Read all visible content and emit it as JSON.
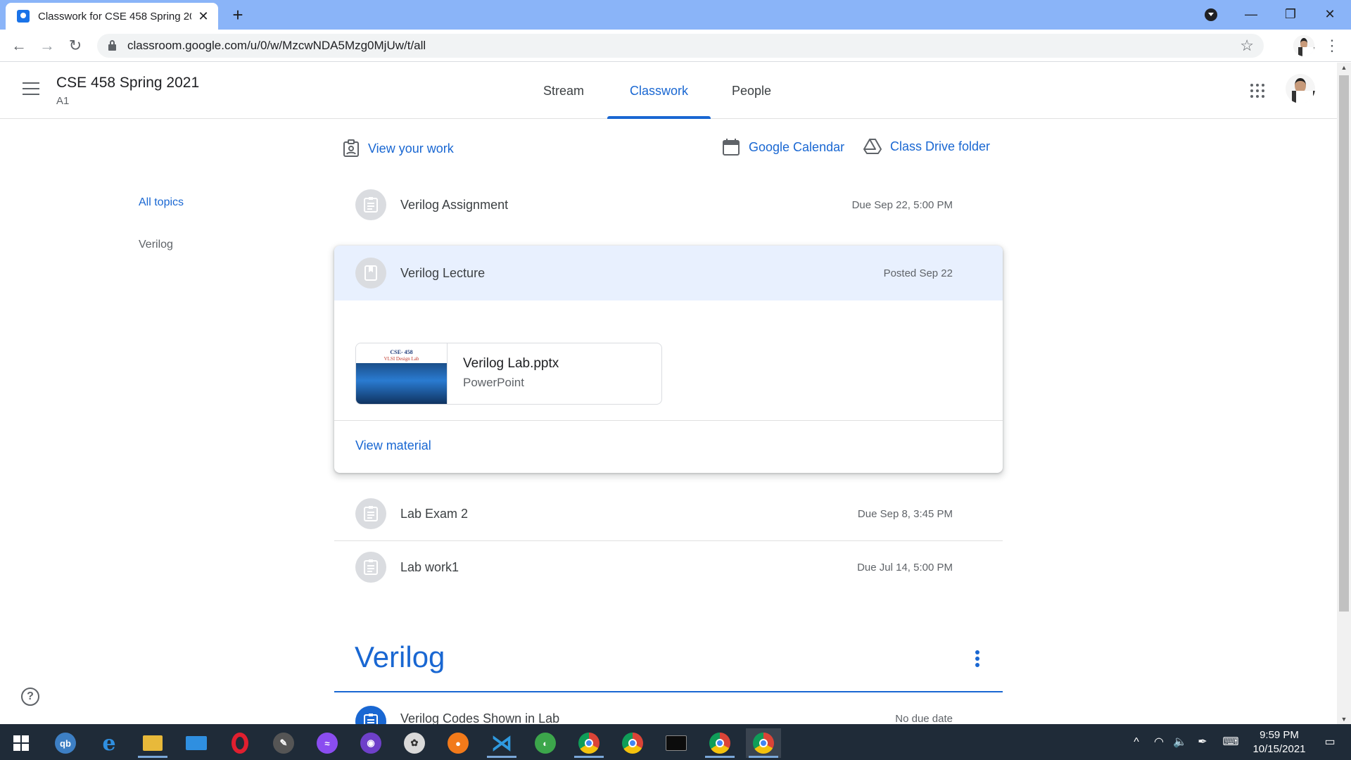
{
  "browser": {
    "tab_title": "Classwork for CSE 458 Spring 20...",
    "url": "classroom.google.com/u/0/w/MzcwNDA5Mzg0MjUw/t/all"
  },
  "header": {
    "class_name": "CSE 458 Spring 2021",
    "section": "A1",
    "tabs": [
      "Stream",
      "Classwork",
      "People"
    ],
    "active_tab": "Classwork"
  },
  "sidebar": {
    "topics": [
      "All topics",
      "Verilog"
    ]
  },
  "actions": {
    "view_work": "View your work",
    "calendar": "Google Calendar",
    "drive": "Class Drive folder"
  },
  "items": [
    {
      "title": "Verilog Assignment",
      "due": "Due Sep 22, 5:00 PM",
      "type": "assignment"
    },
    {
      "title": "Verilog Lecture",
      "due": "Posted Sep 22",
      "type": "material"
    },
    {
      "title": "Lab Exam 2",
      "due": "Due Sep 8, 3:45 PM",
      "type": "assignment"
    },
    {
      "title": "Lab work1",
      "due": "Due Jul 14, 5:00 PM",
      "type": "assignment"
    }
  ],
  "attachment": {
    "name": "Verilog Lab.pptx",
    "type": "PowerPoint",
    "thumb_line1": "CSE- 458",
    "thumb_line2": "VLSI Design Lab"
  },
  "view_material": "View material",
  "topic_section": {
    "title": "Verilog",
    "item_title": "Verilog Codes Shown in Lab",
    "item_due": "No due date"
  },
  "taskbar": {
    "time": "9:59 PM",
    "date": "10/15/2021",
    "apps": [
      "windows-start",
      "qbittorrent",
      "edge",
      "file-explorer",
      "mail",
      "opera",
      "inkscape",
      "messenger",
      "github-desktop",
      "paint",
      "firefox",
      "vscode",
      "earth",
      "chrome",
      "chrome",
      "terminal",
      "chrome-profile",
      "chrome-active"
    ]
  },
  "colors": {
    "accent": "#1967d2",
    "tabstrip": "#8ab4f8",
    "taskbar": "#1f2b38",
    "expanded_header": "#e8f0fe"
  }
}
